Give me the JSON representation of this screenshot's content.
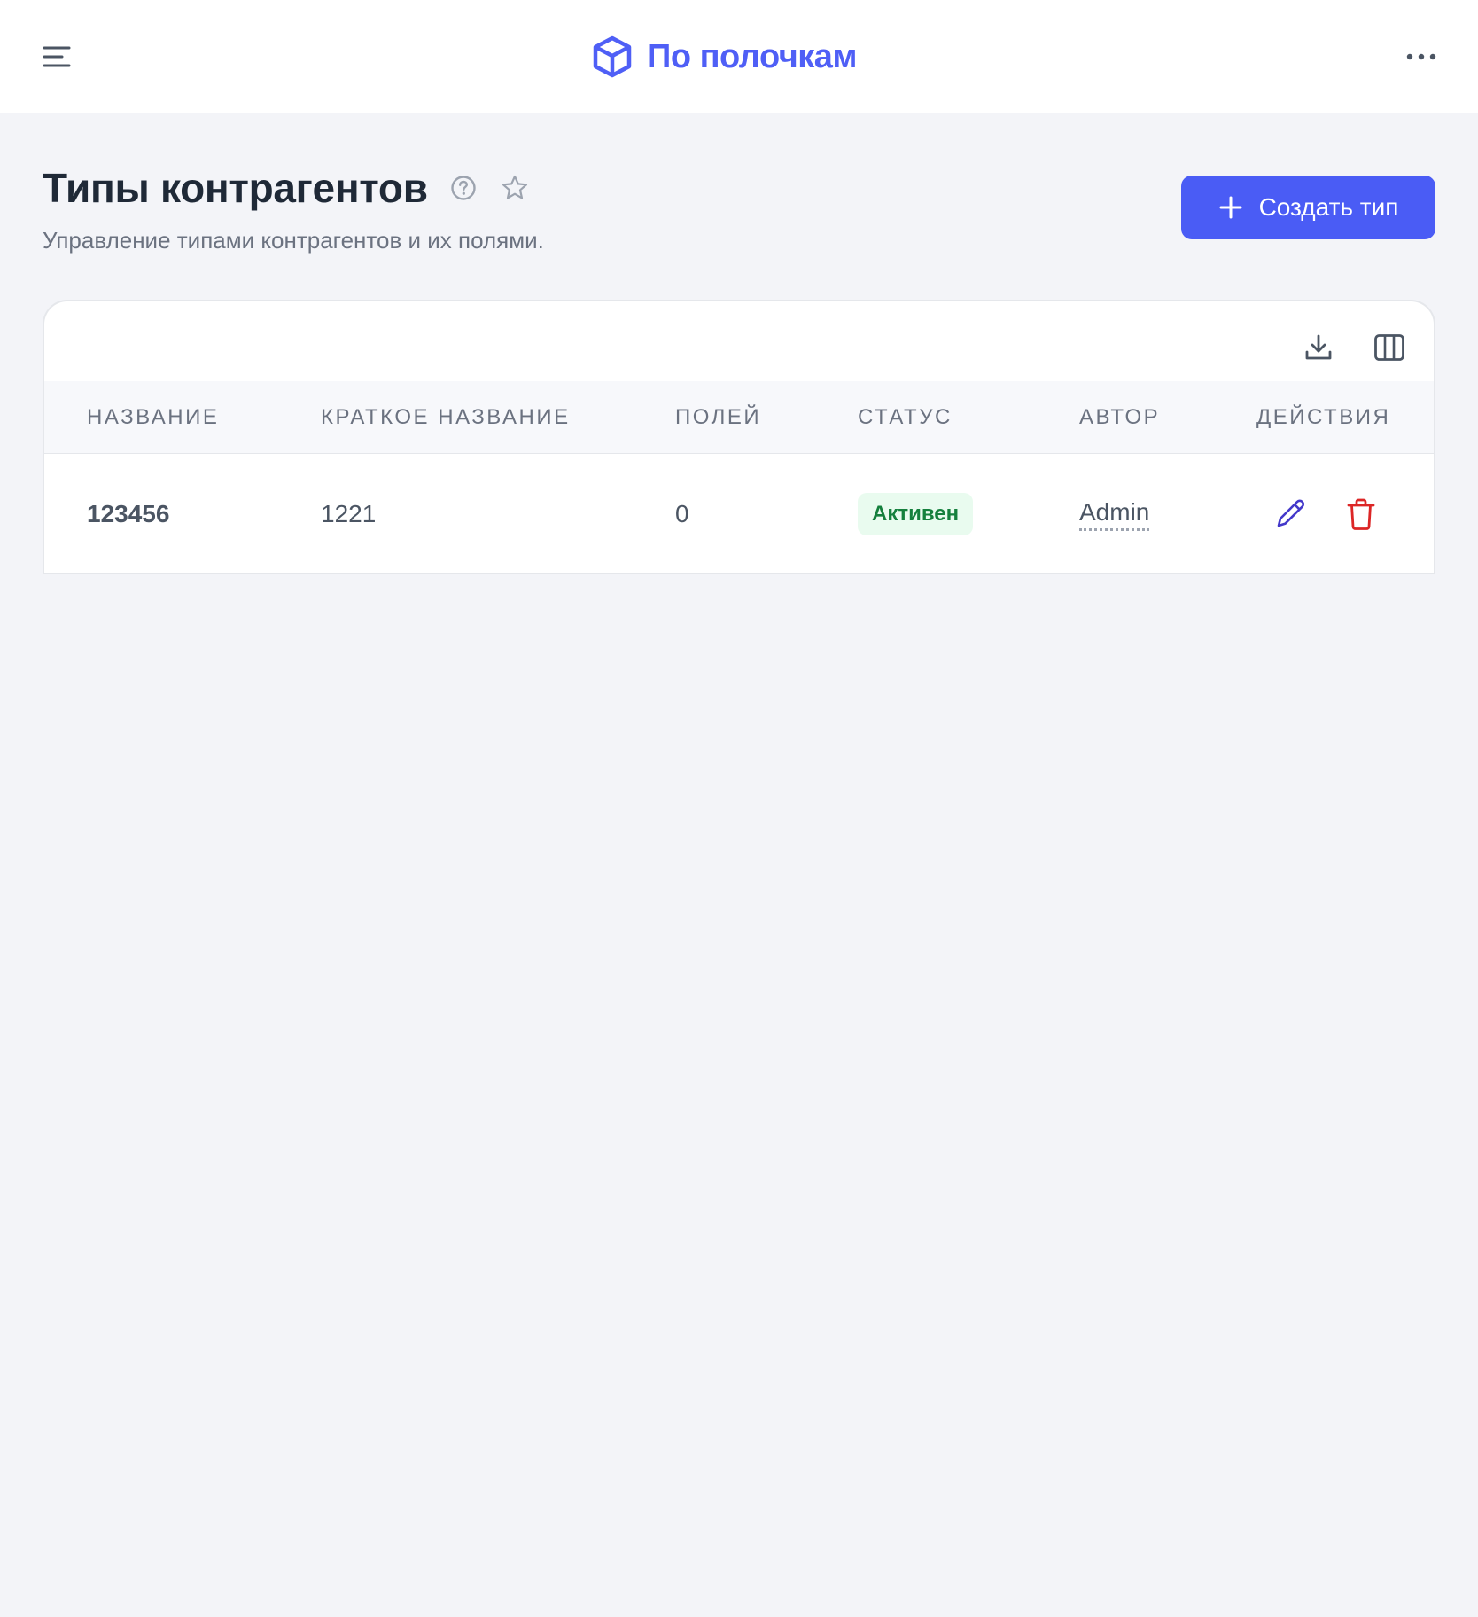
{
  "app": {
    "brand_name": "По полочкам",
    "brand_color": "#4f5ff6"
  },
  "icons": {
    "menu": "menu-lines-icon",
    "brand": "cube-icon",
    "more": "dots-horizontal-icon",
    "help": "question-circle-icon",
    "favorite": "star-icon",
    "plus": "plus-icon",
    "download": "download-icon",
    "columns": "columns-icon",
    "edit": "pencil-icon",
    "delete": "trash-icon"
  },
  "page": {
    "title": "Типы контрагентов",
    "subtitle": "Управление типами контрагентов и их полями.",
    "create_button": "Создать тип"
  },
  "table": {
    "columns": [
      "Название",
      "Краткое название",
      "Полей",
      "Статус",
      "Автор",
      "Действия"
    ],
    "rows": [
      {
        "name": "123456",
        "short_name": "1221",
        "fields": "0",
        "status": "Активен",
        "author": "Admin"
      }
    ]
  },
  "colors": {
    "primary": "#4a5cf5",
    "status_active_bg": "#e9fbef",
    "status_active_text": "#15803d",
    "delete": "#dc2626",
    "edit": "#4338ca"
  }
}
